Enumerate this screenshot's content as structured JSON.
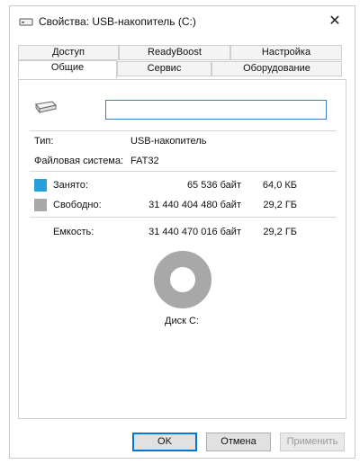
{
  "window": {
    "title": "Свойства: USB-накопитель (C:)",
    "close_glyph": "✕"
  },
  "tabs": {
    "row1": [
      "Доступ",
      "ReadyBoost",
      "Настройка"
    ],
    "row2": [
      "Общие",
      "Сервис",
      "Оборудование"
    ],
    "active": "Общие"
  },
  "general": {
    "name_value": "",
    "type_label": "Тип:",
    "type_value": "USB-накопитель",
    "fs_label": "Файловая система:",
    "fs_value": "FAT32",
    "used_label": "Занято:",
    "used_bytes": "65 536 байт",
    "used_size": "64,0 КБ",
    "free_label": "Свободно:",
    "free_bytes": "31 440 404 480 байт",
    "free_size": "29,2 ГБ",
    "capacity_label": "Емкость:",
    "capacity_bytes": "31 440 470 016 байт",
    "capacity_size": "29,2 ГБ",
    "disk_label": "Диск C:",
    "used_fraction": 2e-06,
    "colors": {
      "used": "#26a0da",
      "free": "#a8a8a8"
    }
  },
  "buttons": {
    "ok": "OK",
    "cancel": "Отмена",
    "apply": "Применить"
  },
  "icons": [
    "usb-drive-icon",
    "close-icon"
  ]
}
